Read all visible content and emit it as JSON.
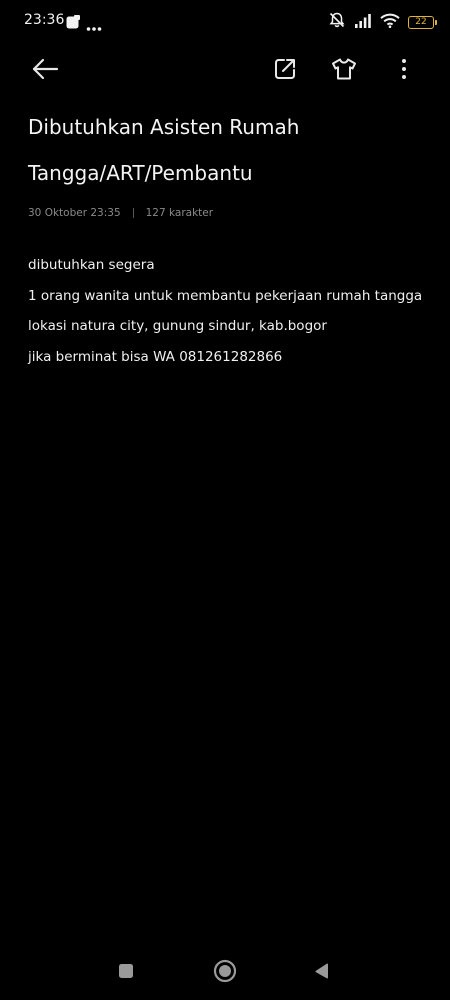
{
  "status_bar": {
    "time": "23:36",
    "notification_icons": [
      "note-app-icon",
      "more-notifications-icon"
    ],
    "right_icons": [
      "mute-icon",
      "signal-icon",
      "wifi-icon"
    ],
    "battery_level": "22",
    "battery_color": "#e0b43a"
  },
  "toolbar": {
    "icons": [
      "back-arrow-icon",
      "share-icon",
      "theme-shirt-icon",
      "more-vertical-icon"
    ]
  },
  "note": {
    "title": "Dibutuhkan Asisten Rumah Tangga/ART/Pembantu",
    "date": "30 Oktober 23:35",
    "char_count": "127 karakter",
    "body_lines": [
      "dibutuhkan segera",
      "1 orang wanita untuk membantu pekerjaan rumah tangga",
      "lokasi natura city, gunung sindur, kab.bogor",
      "jika berminat bisa WA 081261282866"
    ]
  },
  "nav_bar": {
    "icons": [
      "recents-square-icon",
      "home-circle-icon",
      "back-triangle-icon"
    ]
  }
}
